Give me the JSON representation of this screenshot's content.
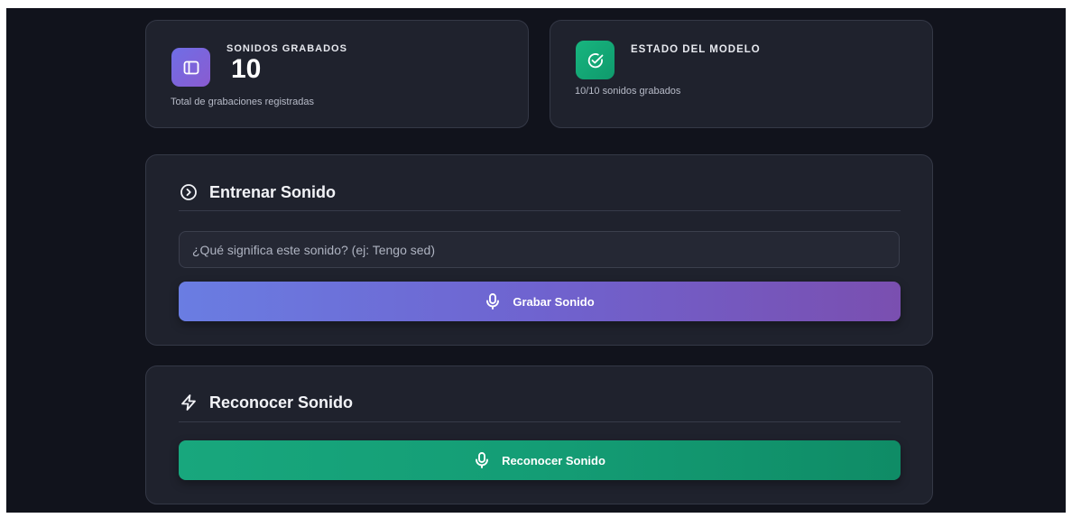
{
  "stats": {
    "recorded": {
      "label": "SONIDOS GRABADOS",
      "value": "10",
      "description": "Total de grabaciones registradas",
      "icon": "sidebar-panel-icon"
    },
    "model": {
      "label": "ESTADO DEL MODELO",
      "description": "10/10 sonidos grabados",
      "icon": "check-circle-icon"
    }
  },
  "train": {
    "title": "Entrenar Sonido",
    "icon": "play-circle-icon",
    "input_placeholder": "¿Qué significa este sonido? (ej: Tengo sed)",
    "input_value": "",
    "button_label": "Grabar Sonido",
    "button_icon": "microphone-icon"
  },
  "recognize": {
    "title": "Reconocer Sonido",
    "icon": "lightning-icon",
    "button_label": "Reconocer Sonido",
    "button_icon": "microphone-icon"
  },
  "colors": {
    "background": "#11131c",
    "card": "#1f222d",
    "accent_purple": "#6f6ee6",
    "accent_green": "#18a77d"
  }
}
